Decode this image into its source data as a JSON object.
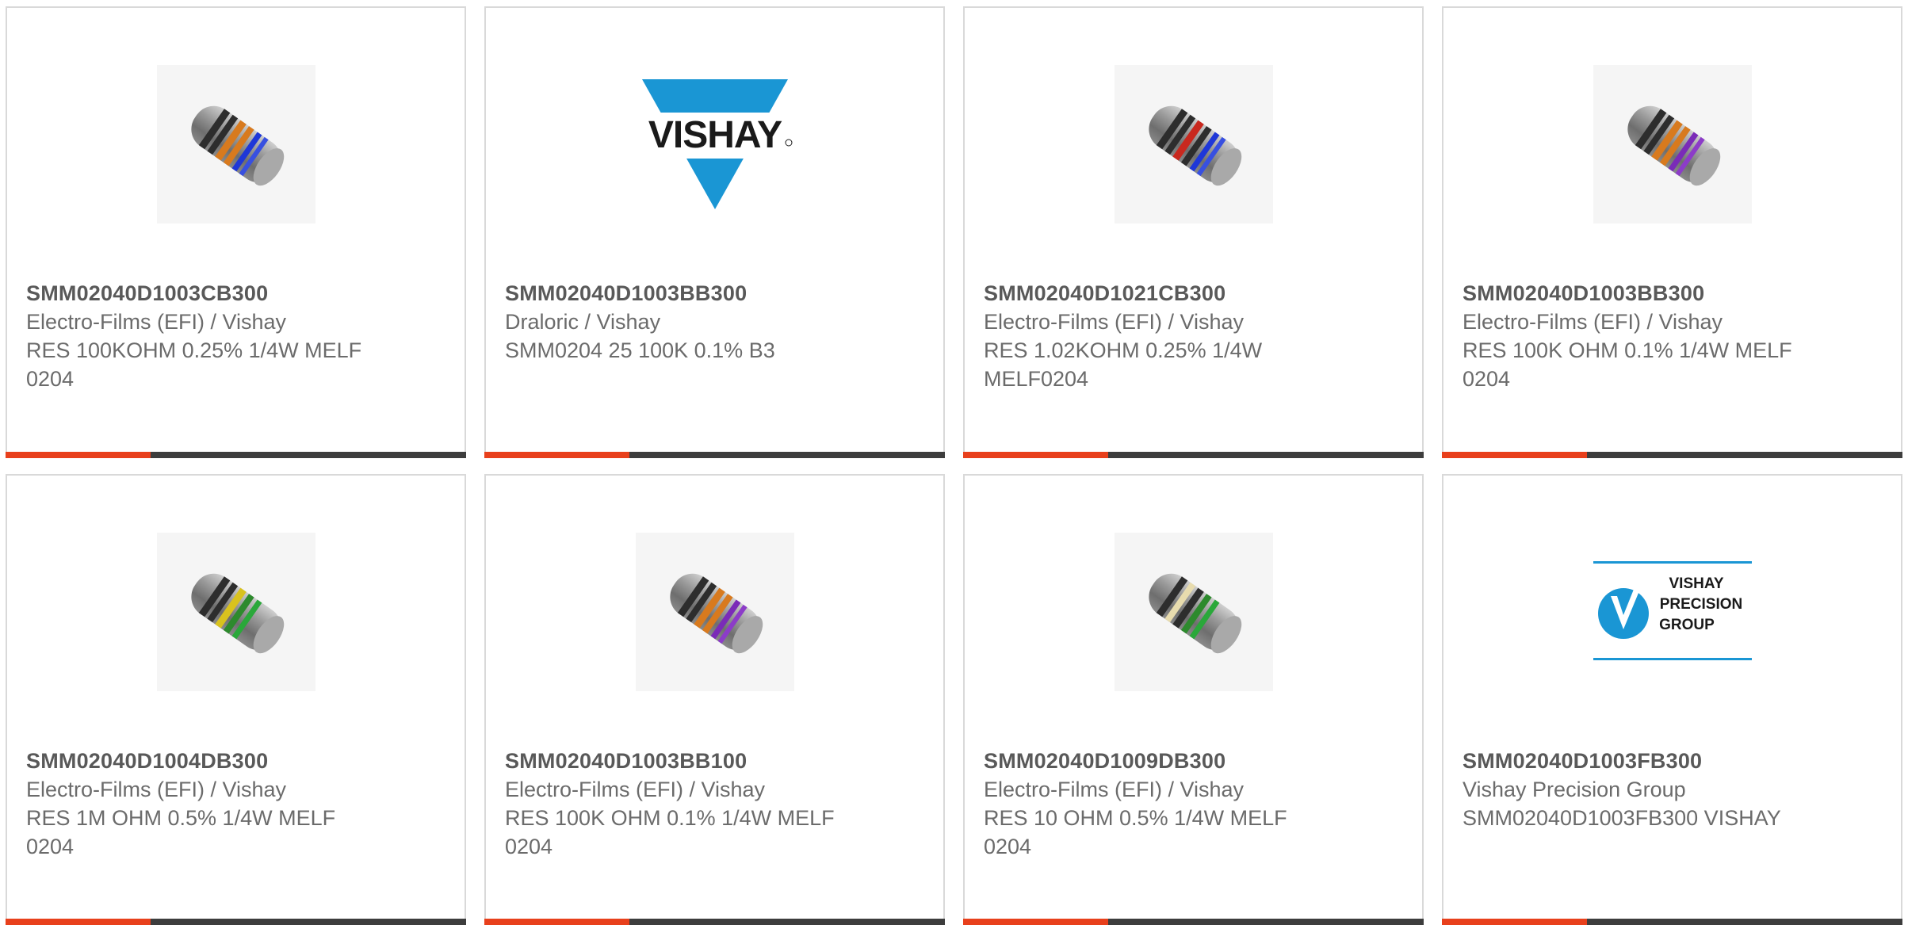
{
  "colors": {
    "accent": "#e8401c",
    "bar_dark": "#3d3d3d",
    "vishay_blue": "#1a96d4"
  },
  "products": [
    {
      "part_number": "SMM02040D1003CB300",
      "manufacturer": "Electro-Films (EFI) / Vishay",
      "description": "RES 100KOHM 0.25% 1/4W MELF 0204",
      "image": "resistor-image"
    },
    {
      "part_number": "SMM02040D1003BB300",
      "manufacturer": "Draloric / Vishay",
      "description": "SMM0204 25 100K 0.1% B3",
      "image": "vishay-logo",
      "logo_text": "VISHAY"
    },
    {
      "part_number": "SMM02040D1021CB300",
      "manufacturer": "Electro-Films (EFI) / Vishay",
      "description": "RES 1.02KOHM 0.25% 1/4W MELF0204",
      "image": "resistor-image"
    },
    {
      "part_number": "SMM02040D1003BB300",
      "manufacturer": "Electro-Films (EFI) / Vishay",
      "description": "RES 100K OHM 0.1% 1/4W MELF 0204",
      "image": "resistor-image"
    },
    {
      "part_number": "SMM02040D1004DB300",
      "manufacturer": "Electro-Films (EFI) / Vishay",
      "description": "RES 1M OHM 0.5% 1/4W MELF 0204",
      "image": "resistor-image"
    },
    {
      "part_number": "SMM02040D1003BB100",
      "manufacturer": "Electro-Films (EFI) / Vishay",
      "description": "RES 100K OHM 0.1% 1/4W MELF 0204",
      "image": "resistor-image"
    },
    {
      "part_number": "SMM02040D1009DB300",
      "manufacturer": "Electro-Films (EFI) / Vishay",
      "description": "RES 10 OHM 0.5% 1/4W MELF 0204",
      "image": "resistor-image"
    },
    {
      "part_number": "SMM02040D1003FB300",
      "manufacturer": "Vishay Precision Group",
      "description": "SMM02040D1003FB300 VISHAY",
      "image": "vpg-logo",
      "logo_lines": [
        "VISHAY",
        "PRECISION",
        "GROUP"
      ]
    }
  ]
}
